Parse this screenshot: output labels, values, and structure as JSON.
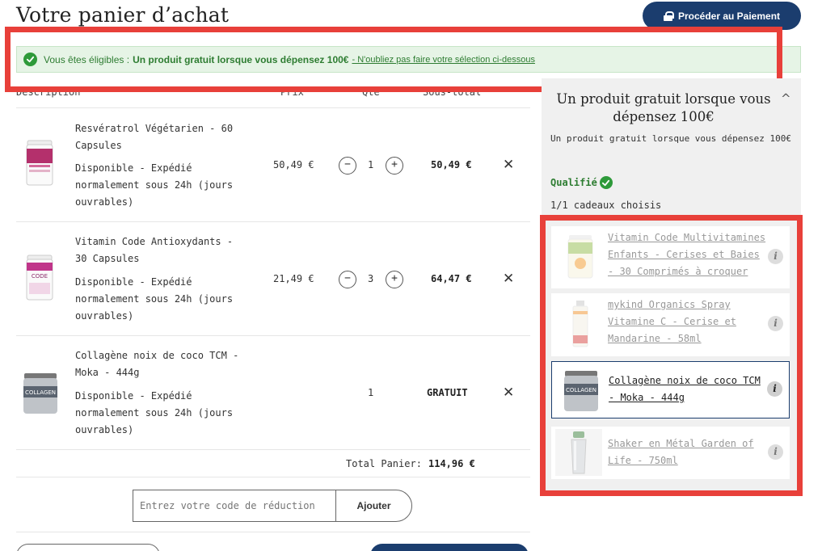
{
  "header": {
    "title": "Votre panier d’achat",
    "checkout_label": "Procéder au Paiement"
  },
  "banner": {
    "prefix": "Vous êtes éligibles :",
    "strong": "Un produit gratuit lorsque vous dépensez 100€",
    "link": "- N'oubliez pas faire votre sélection ci-dessous"
  },
  "table": {
    "headers": {
      "description": "Description",
      "price": "Prix",
      "qty": "Qte",
      "subtotal": "Sous-total"
    },
    "rows": [
      {
        "name": "Resvératrol Végétarien - 60 Capsules",
        "stock": "Disponible - Expédié normalement sous 24h (jours ouvrables)",
        "price": "50,49 €",
        "qty": "1",
        "minus": "−",
        "plus": "+",
        "subtotal": "50,49 €",
        "remove": "✕"
      },
      {
        "name": "Vitamin Code Antioxydants - 30 Capsules",
        "stock": "Disponible - Expédié normalement sous 24h (jours ouvrables)",
        "price": "21,49 €",
        "qty": "3",
        "minus": "−",
        "plus": "+",
        "subtotal": "64,47 €",
        "remove": "✕"
      },
      {
        "name": "Collagène noix de coco TCM - Moka - 444g",
        "stock": "Disponible - Expédié normalement sous 24h (jours ouvrables)",
        "price": "",
        "qty": "1",
        "subtotal": "GRATUIT",
        "remove": "✕"
      }
    ],
    "total_label": "Total Panier:",
    "total_value": "114,96 €"
  },
  "coupon": {
    "placeholder": "Entrez votre code de réduction",
    "button_label": "Ajouter"
  },
  "gift_panel": {
    "title": "Un produit gratuit lorsque vous dépensez 100€",
    "collapse_icon": "^",
    "subtitle": "Un produit gratuit lorsque vous dépensez 100€",
    "qualified_label": "Qualifié",
    "gift_count": "1/1 cadeaux choisis",
    "gifts": [
      {
        "name": "Vitamin Code Multivitamines Enfants - Cerises et Baies - 30 Comprimés à croquer",
        "selected": false,
        "info": "i"
      },
      {
        "name": "mykind Organics Spray Vitamine C - Cerise et Mandarine - 58ml",
        "selected": false,
        "info": "i"
      },
      {
        "name": "Collagène noix de coco TCM - Moka - 444g",
        "selected": true,
        "info": "i"
      },
      {
        "name": "Shaker en Métal Garden of Life - 750ml",
        "selected": false,
        "info": "i"
      }
    ]
  },
  "colors": {
    "brand_navy": "#1b3d6e",
    "success_green": "#2e7d32",
    "highlight_red": "#e8403a",
    "banner_bg": "#e6f4e6",
    "panel_bg": "#f0f0f0"
  }
}
